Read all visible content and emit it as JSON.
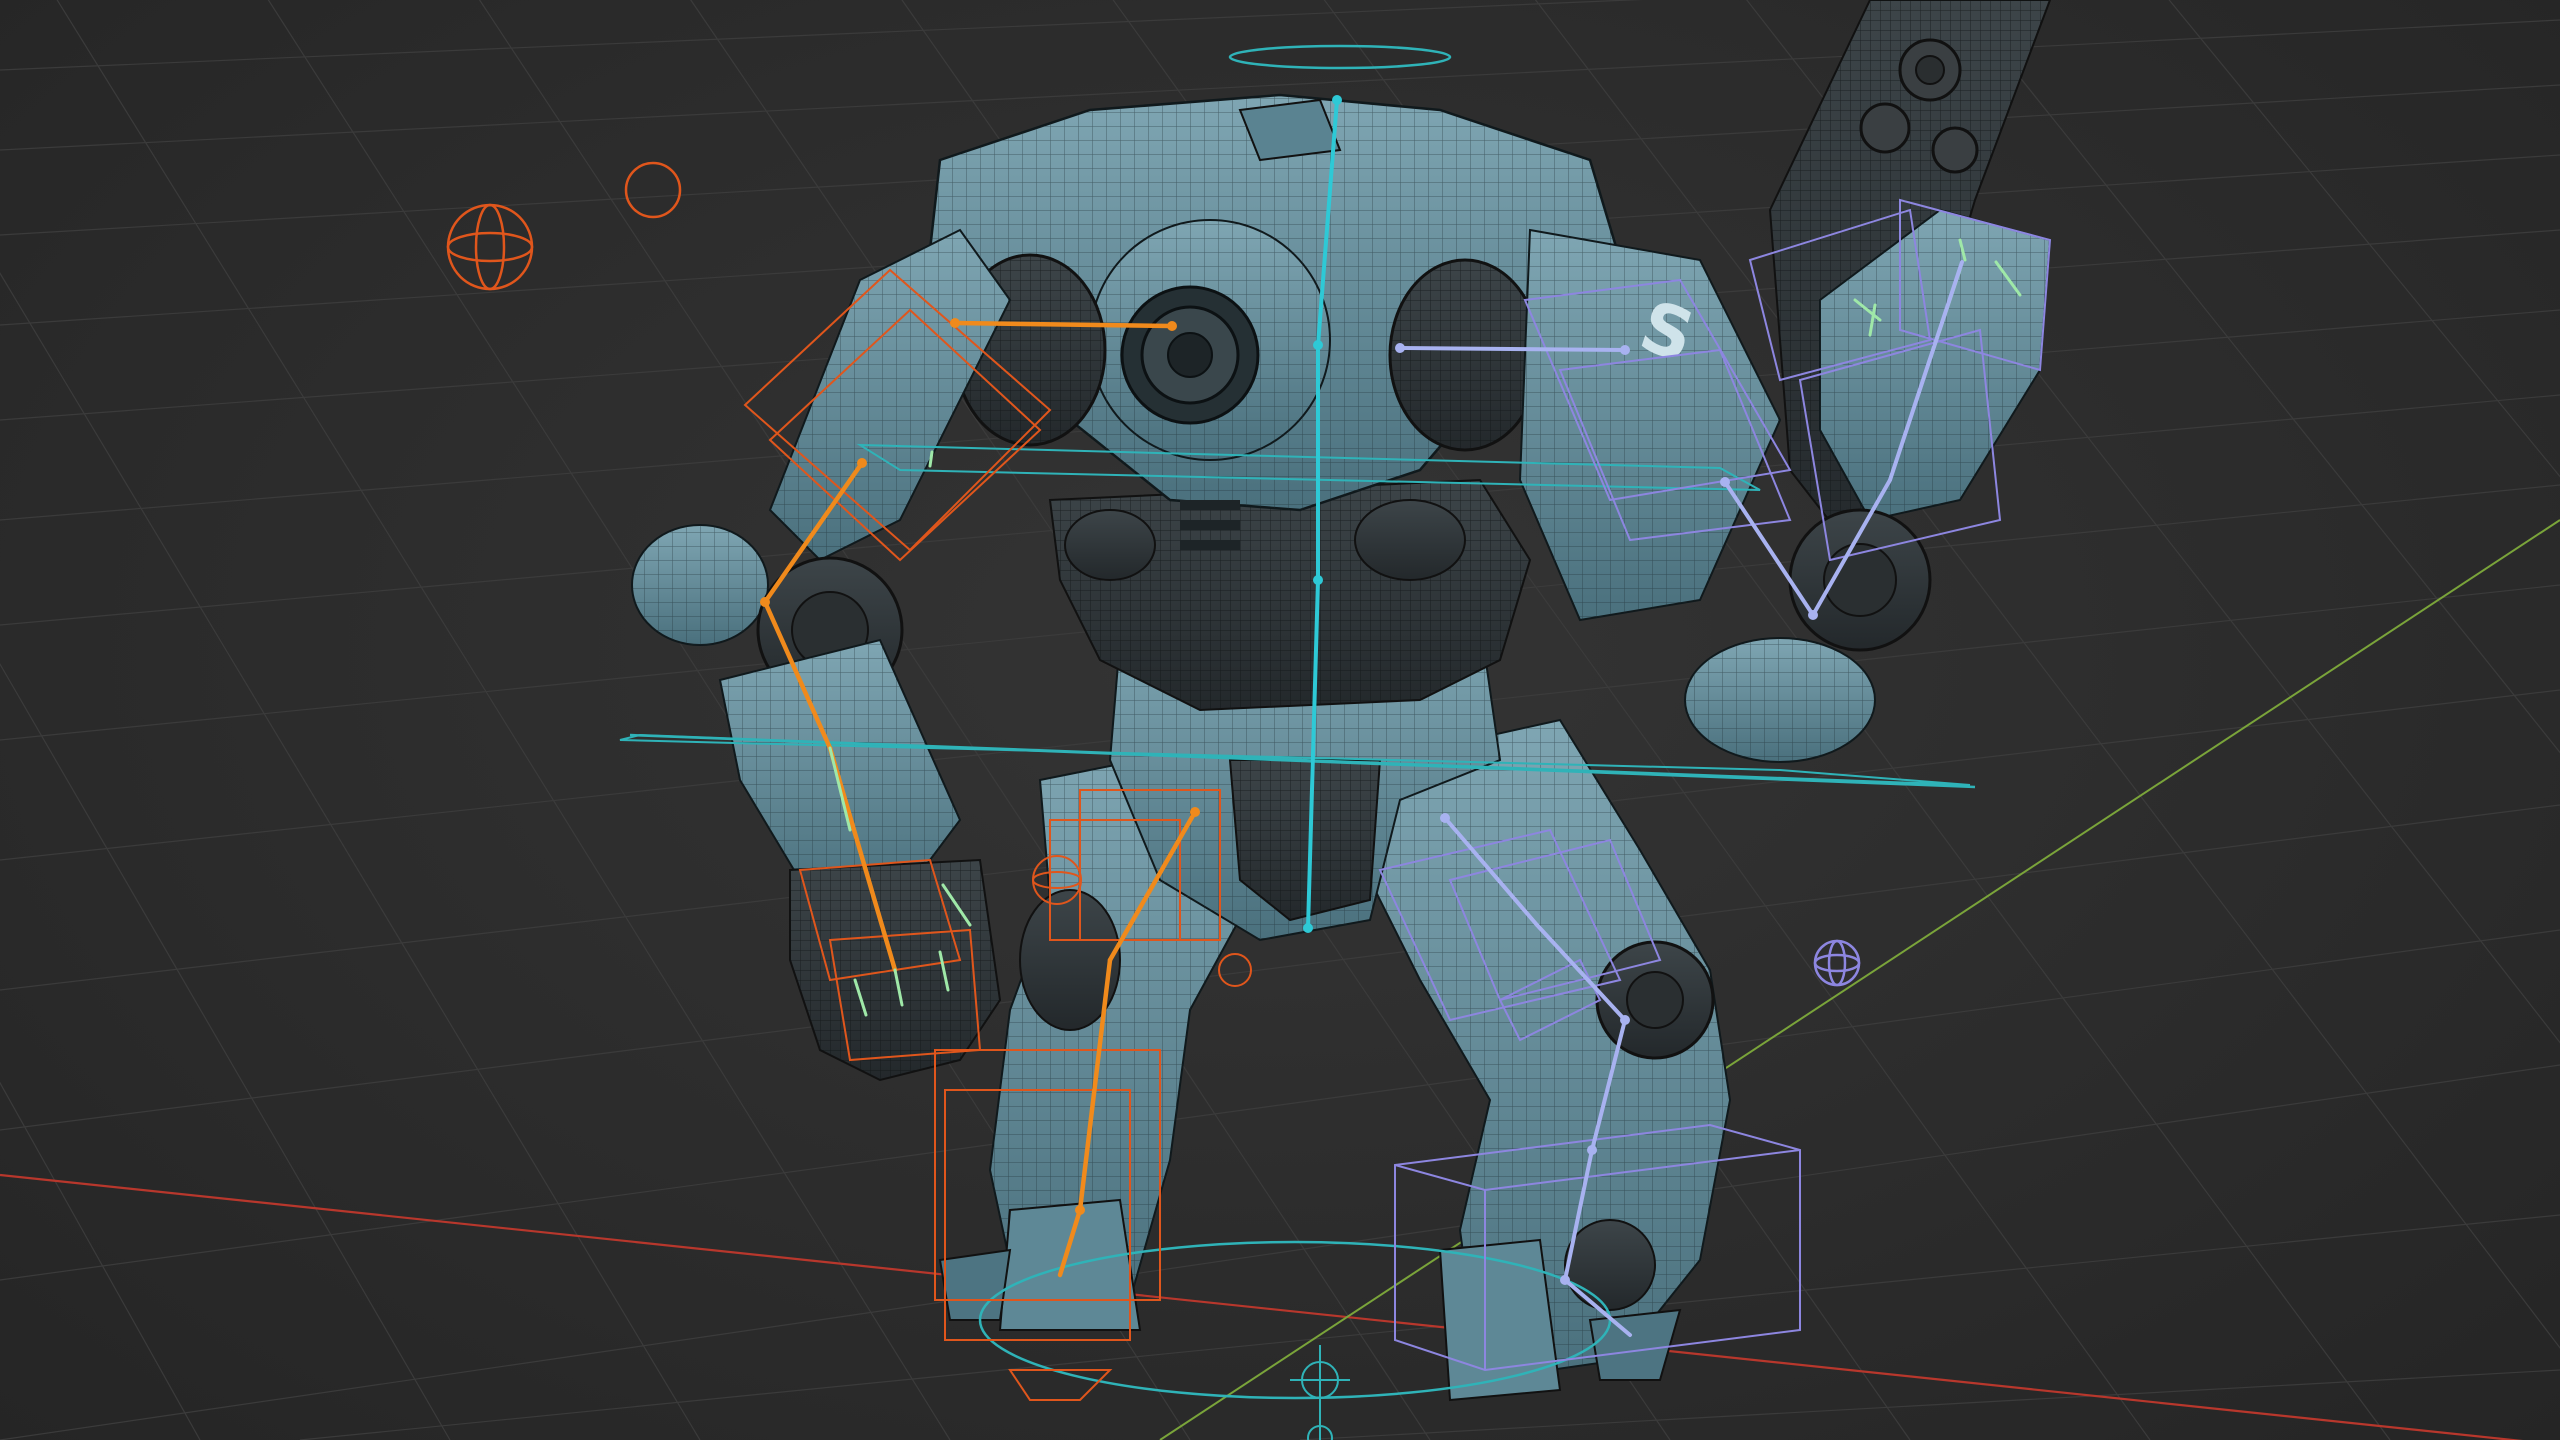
{
  "viewport": {
    "background": "#2b2b2b",
    "grid_color": "#3a3a3a",
    "x_axis_color": "#c0392b",
    "y_axis_color": "#7fa63a"
  },
  "rig": {
    "mesh_color": "#5f8a99",
    "mesh_dark_color": "#2f3a3f",
    "spine_bone_color": "#2ec9d6",
    "left_bone_color": "#f08a1c",
    "right_bone_color": "#a8b2f0",
    "control_orange": "#e0561c",
    "control_cyan": "#2fb3b8",
    "control_violet": "#8d86e0",
    "finger_bone_color": "#9fe8a8",
    "icons": [
      "sphere-control-icon",
      "circle-control-icon",
      "root-control-icon"
    ]
  }
}
